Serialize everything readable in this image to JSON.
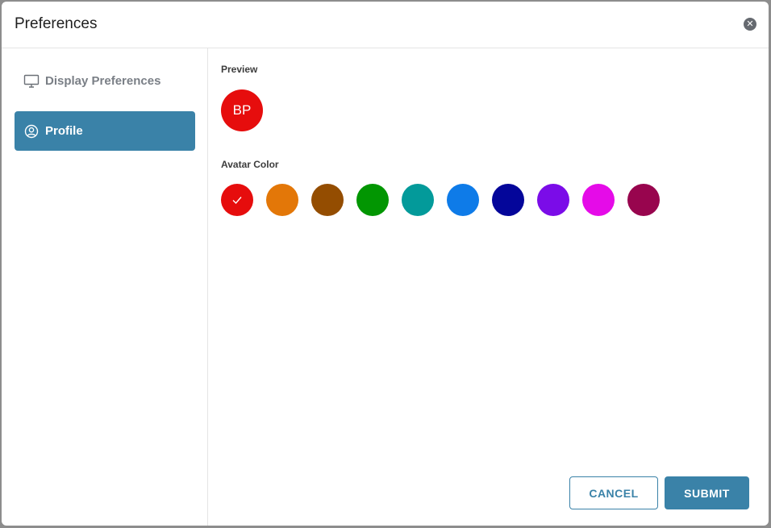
{
  "dialog": {
    "title": "Preferences",
    "close_icon": "close-icon"
  },
  "sidebar": {
    "items": [
      {
        "label": "Display Preferences",
        "icon": "monitor-icon",
        "active": false
      },
      {
        "label": "Profile",
        "icon": "user-circle-icon",
        "active": true
      }
    ]
  },
  "profile": {
    "preview_label": "Preview",
    "avatar_initials": "BP",
    "avatar_color": "#e60d0d",
    "color_label": "Avatar Color",
    "colors": [
      {
        "hex": "#e60d0d",
        "selected": true
      },
      {
        "hex": "#e37708",
        "selected": false
      },
      {
        "hex": "#944d01",
        "selected": false
      },
      {
        "hex": "#029602",
        "selected": false
      },
      {
        "hex": "#039a9a",
        "selected": false
      },
      {
        "hex": "#0e7be8",
        "selected": false
      },
      {
        "hex": "#04069a",
        "selected": false
      },
      {
        "hex": "#7b0ce8",
        "selected": false
      },
      {
        "hex": "#e50be8",
        "selected": false
      },
      {
        "hex": "#98054e",
        "selected": false
      }
    ]
  },
  "actions": {
    "cancel_label": "CANCEL",
    "submit_label": "SUBMIT"
  },
  "theme": {
    "accent": "#3a82a8"
  }
}
